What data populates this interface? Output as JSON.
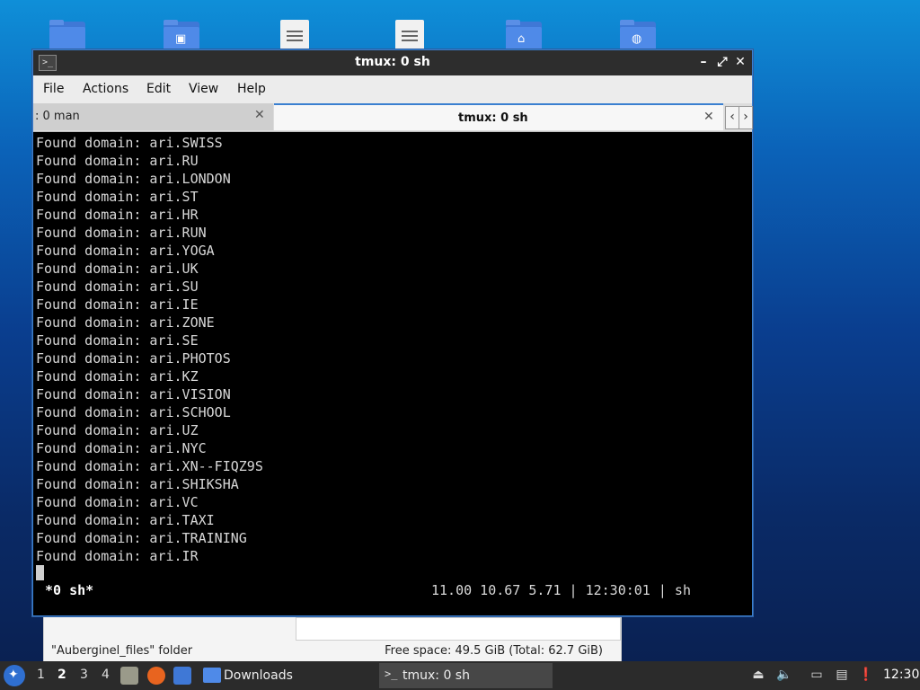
{
  "window": {
    "title": "tmux: 0 sh",
    "controls": {
      "minimize": "–",
      "maximize": "⤢",
      "close": "✕"
    }
  },
  "menu": [
    "File",
    "Actions",
    "Edit",
    "View",
    "Help"
  ],
  "tabs": [
    {
      "label": ": 0 man",
      "active": false
    },
    {
      "label": "tmux: 0 sh",
      "active": true
    }
  ],
  "terminal": {
    "lines": [
      "Found domain: ari.SWISS",
      "Found domain: ari.RU",
      "Found domain: ari.LONDON",
      "Found domain: ari.ST",
      "Found domain: ari.HR",
      "Found domain: ari.RUN",
      "Found domain: ari.YOGA",
      "Found domain: ari.UK",
      "Found domain: ari.SU",
      "Found domain: ari.IE",
      "Found domain: ari.ZONE",
      "Found domain: ari.SE",
      "Found domain: ari.PHOTOS",
      "Found domain: ari.KZ",
      "Found domain: ari.VISION",
      "Found domain: ari.SCHOOL",
      "Found domain: ari.UZ",
      "Found domain: ari.NYC",
      "Found domain: ari.XN--FIQZ9S",
      "Found domain: ari.SHIKSHA",
      "Found domain: ari.VC",
      "Found domain: ari.TAXI",
      "Found domain: ari.TRAINING",
      "Found domain: ari.IR"
    ],
    "status_left": "*0 sh*",
    "status_right": "11.00 10.67 5.71 | 12:30:01 | sh"
  },
  "file_manager": {
    "status_left": "\"Auberginel_files\" folder",
    "status_right": "Free space: 49.5 GiB (Total: 62.7 GiB)"
  },
  "taskbar": {
    "workspaces": [
      "1",
      "2",
      "3",
      "4"
    ],
    "active_workspace": "2",
    "tasks": [
      {
        "label": "Downloads",
        "icon": "folder-icon"
      },
      {
        "label": "tmux: 0 sh",
        "icon": "terminal-icon",
        "active": true
      }
    ],
    "clock": "12:30"
  },
  "colors": {
    "accent": "#3a7fd0",
    "terminal_bg": "#000000",
    "titlebar": "#2d2d2d",
    "taskbar": "#2b2b2b"
  }
}
